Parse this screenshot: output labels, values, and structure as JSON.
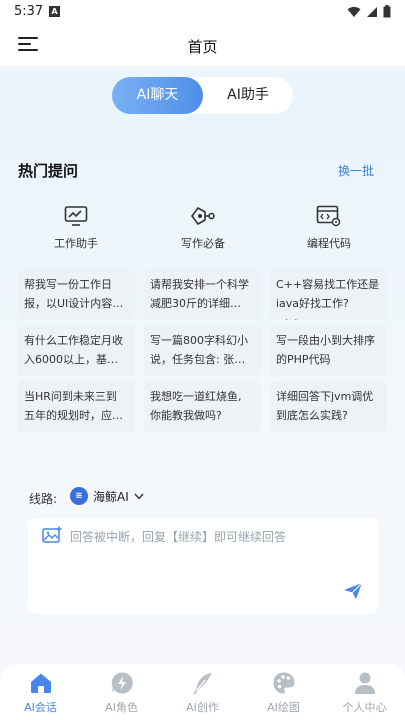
{
  "status": {
    "time": "5:37",
    "notification_icon": "A"
  },
  "header": {
    "title": "首页"
  },
  "mode_tabs": [
    {
      "label": "AI聊天"
    },
    {
      "label": "AI助手"
    }
  ],
  "hot": {
    "title": "热门提问",
    "refresh_label": "换一批",
    "categories": [
      {
        "label": "工作助手",
        "icon": "monitor-chart-icon"
      },
      {
        "label": "写作必备",
        "icon": "pen-nib-icon"
      },
      {
        "label": "编程代码",
        "icon": "code-window-icon"
      }
    ],
    "questions": [
      {
        "line1": "帮我写一份工作日",
        "line2": "报，以UI设计内容…"
      },
      {
        "line1": "请帮我安排一个科学",
        "line2": "减肥30斤的详细…"
      },
      {
        "line1": "C++容易找工作还是",
        "line2": "iava好找工作?c++…"
      },
      {
        "line1": "有什么工作稳定月收",
        "line2": "入6000以上，基…"
      },
      {
        "line1": "写一篇800字科幻小",
        "line2": "说，任务包含: 张…"
      },
      {
        "line1": "写一段由小到大排序",
        "line2": "的PHP代码"
      },
      {
        "line1": "当HR问到未来三到",
        "line2": "五年的规划时，应…"
      },
      {
        "line1": "我想吃一道红烧鱼,",
        "line2": "你能教我做吗?"
      },
      {
        "line1": "详细回答下jvm调优",
        "line2": "到底怎么实践?"
      }
    ]
  },
  "route": {
    "label": "线路:",
    "value": "海鲸AI"
  },
  "input": {
    "placeholder": "回答被中断，回复【继续】即可继续回答"
  },
  "tabbar": [
    {
      "label": "AI会话",
      "icon": "home-icon",
      "active": true
    },
    {
      "label": "AI角色",
      "icon": "lightning-bubble-icon",
      "active": false
    },
    {
      "label": "AI创作",
      "icon": "feather-icon",
      "active": false
    },
    {
      "label": "AI绘图",
      "icon": "palette-icon",
      "active": false
    },
    {
      "label": "个人中心",
      "icon": "person-icon",
      "active": false
    }
  ],
  "colors": {
    "accent": "#4a86ea",
    "card_bg": "#edf2f7",
    "inactive_tab": "#a0a6ad"
  }
}
